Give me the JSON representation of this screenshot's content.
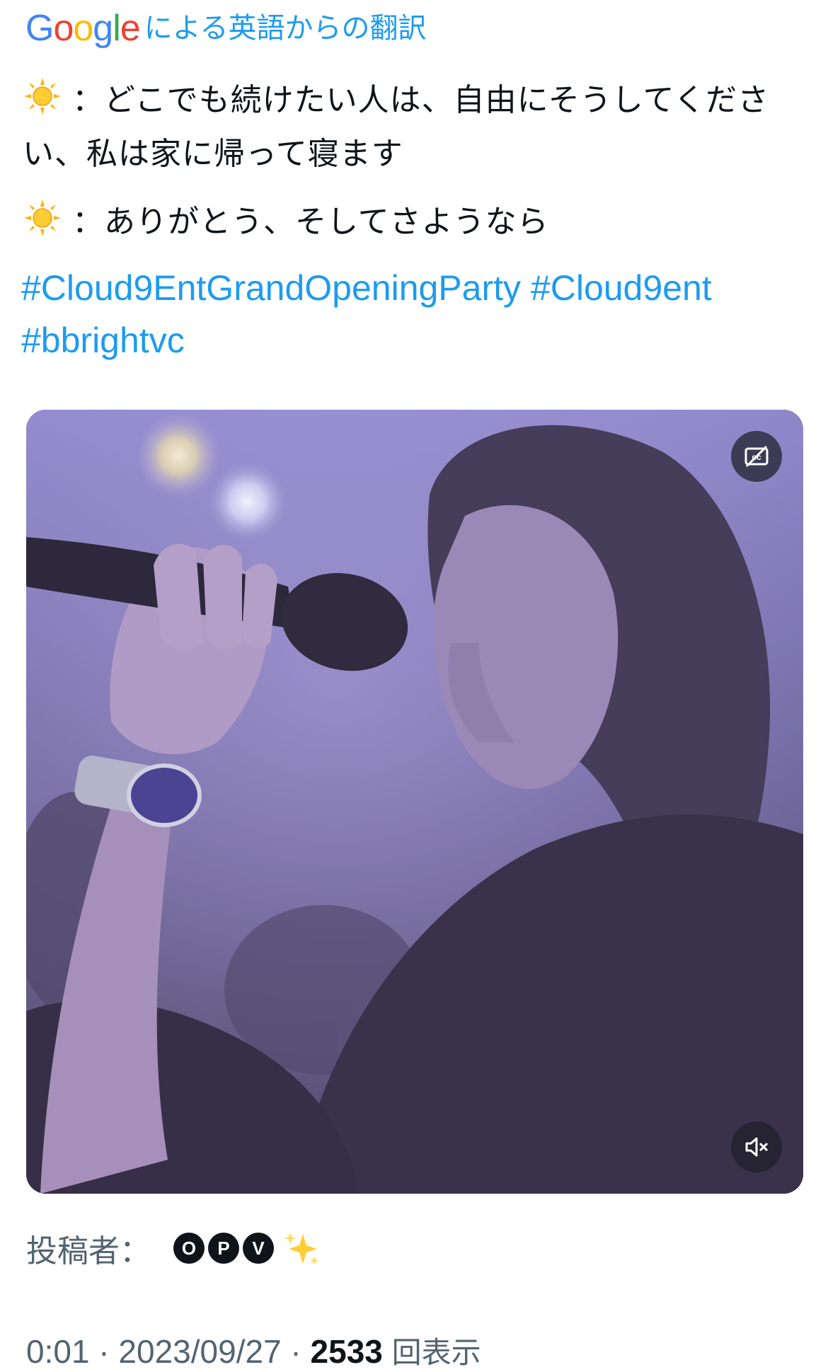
{
  "translation": {
    "google_letters": [
      "G",
      "o",
      "o",
      "g",
      "l",
      "e"
    ],
    "google_colors": [
      "#4285F4",
      "#EA4335",
      "#FBBC05",
      "#4285F4",
      "#34A853",
      "#EA4335"
    ],
    "label": "による英語からの翻訳"
  },
  "tweet": {
    "line1_text": "：どこでも続けたい人は、自由にそうしてください、私は家に帰って寝ます",
    "line2_text": "：ありがとう、そしてさようなら",
    "sun_icon": "sun-emoji",
    "hashtags": [
      "#Cloud9EntGrandOpeningParty",
      "#Cloud9ent",
      "#bbrightvc"
    ],
    "link_color": "#1d9bf0"
  },
  "video": {
    "cc_icon": "captions-off-icon",
    "mute_icon": "speaker-muted-icon"
  },
  "posted_by": {
    "label": "投稿者：",
    "badge_letters": [
      "O",
      "P",
      "V"
    ],
    "sparkle_icon": "sparkles-emoji"
  },
  "meta": {
    "time": "0:01",
    "separator": " · ",
    "date": "2023/09/27",
    "views_count": "2533",
    "views_label": "回表示"
  }
}
